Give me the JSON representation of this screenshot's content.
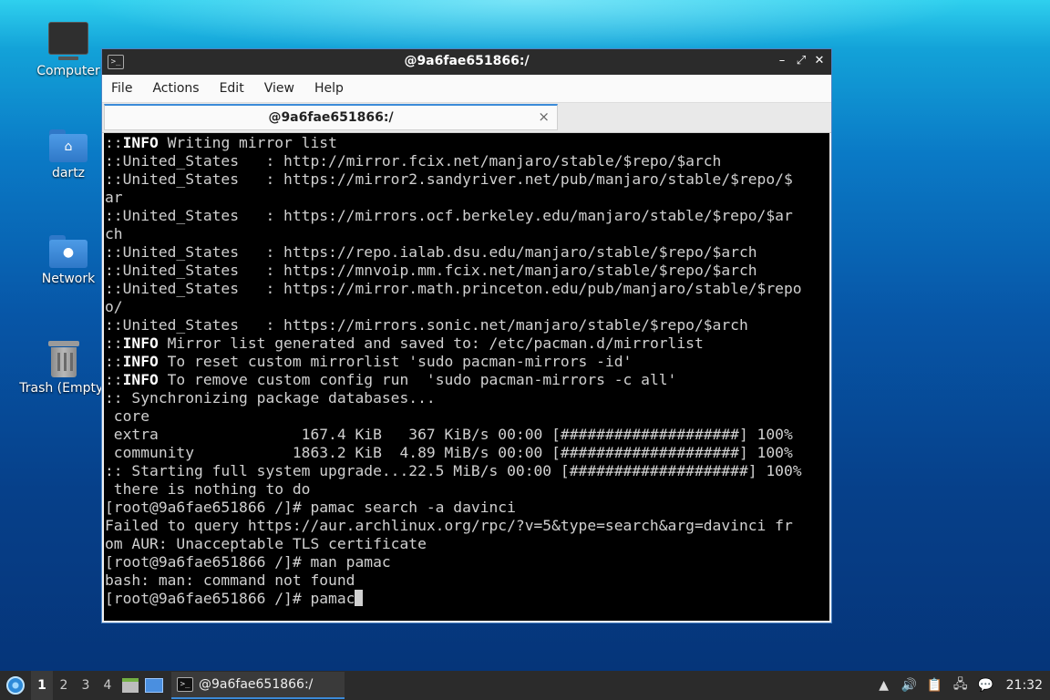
{
  "desktop": {
    "icons": [
      {
        "label": "Computer"
      },
      {
        "label": "dartz"
      },
      {
        "label": "Network"
      },
      {
        "label": "Trash (Empty)"
      }
    ]
  },
  "window": {
    "title": "@9a6fae651866:/",
    "menu": [
      "File",
      "Actions",
      "Edit",
      "View",
      "Help"
    ],
    "tab_title": "@9a6fae651866:/",
    "close_tab_glyph": "×",
    "controls": {
      "minimize": "–",
      "maximize": "⤢",
      "close": "✕"
    }
  },
  "terminal": {
    "lines": [
      {
        "prefix": "::",
        "bold": "INFO",
        "text": " Writing mirror list"
      },
      {
        "text": "::United_States   : http://mirror.fcix.net/manjaro/stable/$repo/$arch"
      },
      {
        "text": "::United_States   : https://mirror2.sandyriver.net/pub/manjaro/stable/$repo/$"
      },
      {
        "text": "ar"
      },
      {
        "text": "::United_States   : https://mirrors.ocf.berkeley.edu/manjaro/stable/$repo/$ar"
      },
      {
        "text": "ch"
      },
      {
        "text": "::United_States   : https://repo.ialab.dsu.edu/manjaro/stable/$repo/$arch"
      },
      {
        "text": "::United_States   : https://mnvoip.mm.fcix.net/manjaro/stable/$repo/$arch"
      },
      {
        "text": "::United_States   : https://mirror.math.princeton.edu/pub/manjaro/stable/$repo"
      },
      {
        "text": "o/"
      },
      {
        "text": "::United_States   : https://mirrors.sonic.net/manjaro/stable/$repo/$arch"
      },
      {
        "prefix": "::",
        "bold": "INFO",
        "text": " Mirror list generated and saved to: /etc/pacman.d/mirrorlist"
      },
      {
        "prefix": "::",
        "bold": "INFO",
        "text": " To reset custom mirrorlist 'sudo pacman-mirrors -id'"
      },
      {
        "prefix": "::",
        "bold": "INFO",
        "text": " To remove custom config run  'sudo pacman-mirrors -c all'"
      },
      {
        "text": ":: Synchronizing package databases..."
      },
      {
        "text": " core"
      },
      {
        "text": " extra                167.4 KiB   367 KiB/s 00:00 [####################] 100%"
      },
      {
        "text": " community           1863.2 KiB  4.89 MiB/s 00:00 [####################] 100%"
      },
      {
        "text": ":: Starting full system upgrade...22.5 MiB/s 00:00 [####################] 100%"
      },
      {
        "text": " there is nothing to do"
      },
      {
        "text": "[root@9a6fae651866 /]# pamac search -a davinci"
      },
      {
        "text": "Failed to query https://aur.archlinux.org/rpc/?v=5&type=search&arg=davinci fr"
      },
      {
        "text": "om AUR: Unacceptable TLS certificate"
      },
      {
        "text": "[root@9a6fae651866 /]# man pamac"
      },
      {
        "text": "bash: man: command not found"
      }
    ],
    "prompt": "[root@9a6fae651866 /]# ",
    "input": "pamac"
  },
  "taskbar": {
    "workspaces": [
      "1",
      "2",
      "3",
      "4"
    ],
    "active_workspace": "1",
    "task_label": "@9a6fae651866:/",
    "clock": "21:32"
  }
}
